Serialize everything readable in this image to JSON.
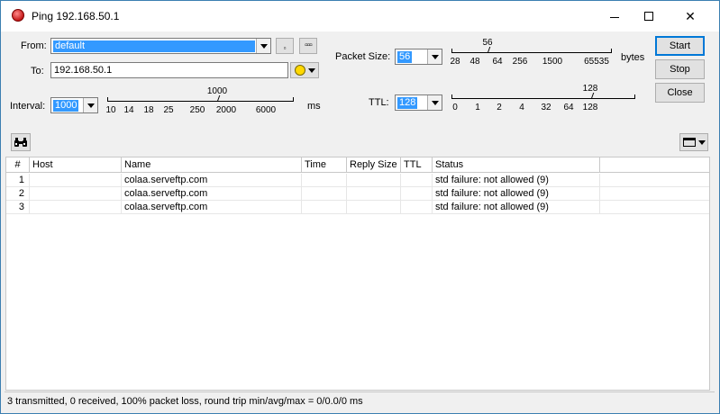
{
  "window": {
    "title": "Ping 192.168.50.1"
  },
  "form": {
    "from_label": "From:",
    "from_value": "default",
    "to_label": "To:",
    "to_value": "192.168.50.1",
    "interval_label": "Interval:",
    "interval_value": "1000",
    "interval_unit": "ms",
    "packet_size_label": "Packet Size:",
    "packet_size_value": "56",
    "packet_size_unit": "bytes",
    "ttl_label": "TTL:",
    "ttl_value": "128"
  },
  "sliders": {
    "packet": {
      "current": "56",
      "ticks": [
        "28",
        "48",
        "64",
        "256",
        "1500",
        "65535"
      ]
    },
    "interval": {
      "current": "1000",
      "ticks": [
        "10",
        "14",
        "18",
        "25",
        "250",
        "2000",
        "6000"
      ]
    },
    "ttl": {
      "current": "128",
      "ticks": [
        "0",
        "1",
        "2",
        "4",
        "32",
        "64",
        "128"
      ]
    }
  },
  "buttons": {
    "start": "Start",
    "stop": "Stop",
    "close": "Close"
  },
  "table": {
    "columns": [
      "#",
      "Host",
      "Name",
      "Time",
      "Reply Size",
      "TTL",
      "Status"
    ],
    "rows": [
      {
        "num": "1",
        "host": "",
        "name": "colaa.serveftp.com",
        "time": "",
        "reply_size": "",
        "ttl": "",
        "status": "std failure: not allowed (9)"
      },
      {
        "num": "2",
        "host": "",
        "name": "colaa.serveftp.com",
        "time": "",
        "reply_size": "",
        "ttl": "",
        "status": "std failure: not allowed (9)"
      },
      {
        "num": "3",
        "host": "",
        "name": "colaa.serveftp.com",
        "time": "",
        "reply_size": "",
        "ttl": "",
        "status": "std failure: not allowed (9)"
      }
    ]
  },
  "status_bar": "3 transmitted, 0 received, 100% packet loss, round trip min/avg/max = 0/0.0/0 ms",
  "icons": {
    "app": "ping-app-icon",
    "find": "binoculars-icon",
    "columns": "columns-menu-icon",
    "dns": "smiley-dns-icon"
  },
  "colors": {
    "selection": "#3399ff",
    "window_border": "#3c7fb1"
  }
}
